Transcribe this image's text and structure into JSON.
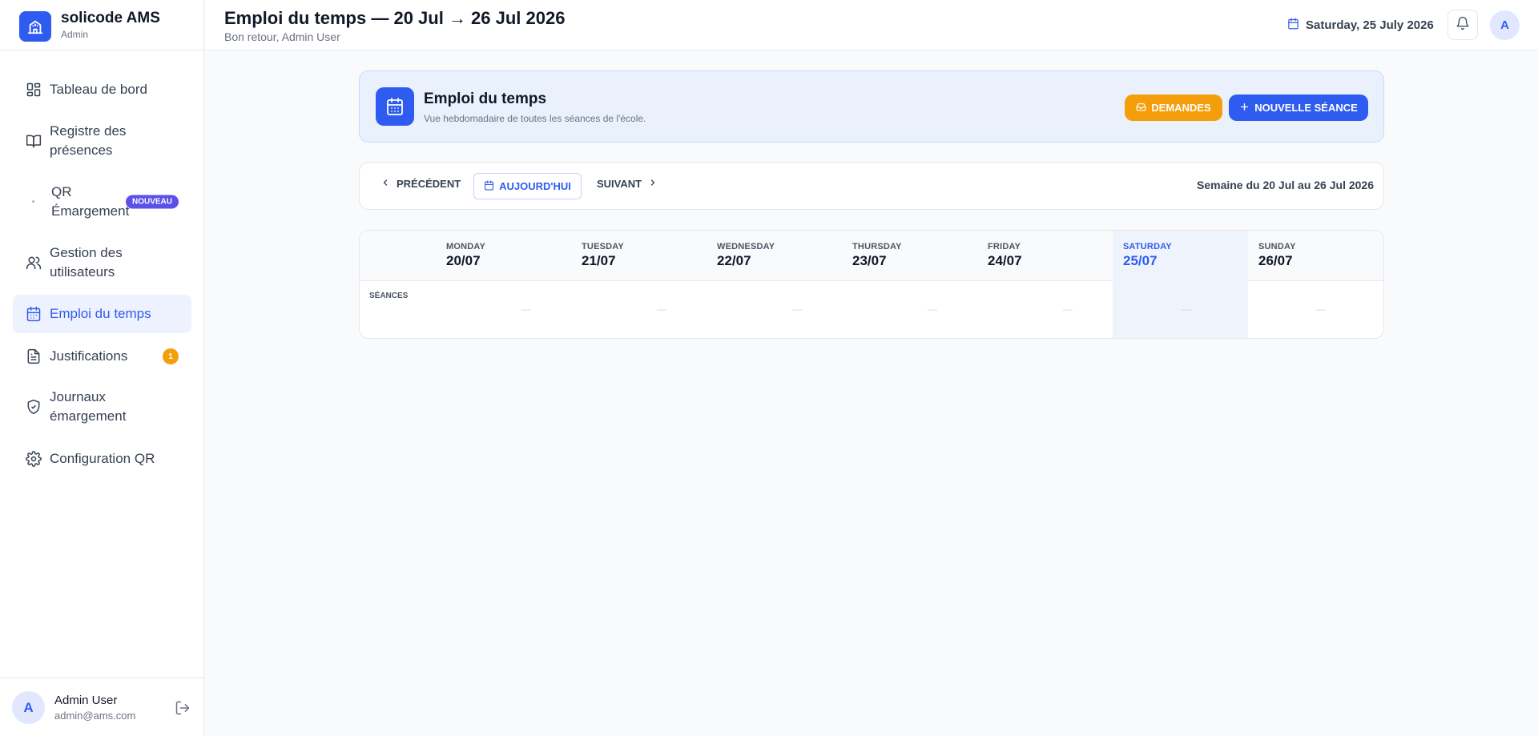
{
  "brand": {
    "name": "solicode AMS",
    "role": "Admin"
  },
  "sidebar": {
    "items": [
      {
        "label": "Tableau de bord",
        "icon": "dashboard-icon"
      },
      {
        "label": "Registre des présences",
        "icon": "book-open-icon"
      },
      {
        "label": "QR Émargement",
        "icon": "qr-icon",
        "badge": "NOUVEAU"
      },
      {
        "label": "Gestion des utilisateurs",
        "icon": "users-icon"
      },
      {
        "label": "Emploi du temps",
        "icon": "calendar-icon",
        "active": true
      },
      {
        "label": "Justifications",
        "icon": "file-text-icon",
        "badge": "1"
      },
      {
        "label": "Journaux émargement",
        "icon": "shield-check-icon"
      },
      {
        "label": "Configuration QR",
        "icon": "gear-icon"
      }
    ]
  },
  "user": {
    "initial": "A",
    "name": "Admin User",
    "email": "admin@ams.com"
  },
  "header": {
    "title": "Emploi du temps — 20 Jul → 26 Jul 2026",
    "subtitle": "Bon retour, Admin User",
    "date": "Saturday, 25 July 2026",
    "avatar_initial": "A"
  },
  "banner": {
    "title": "Emploi du temps",
    "subtitle": "Vue hebdomadaire de toutes les séances de l'école.",
    "demandes_label": "DEMANDES",
    "new_session_label": "NOUVELLE SÉANCE"
  },
  "weeknav": {
    "prev_label": "PRÉCÉDENT",
    "today_label": "AUJOURD'HUI",
    "next_label": "SUIVANT",
    "range_label": "Semaine du 20 Jul au 26 Jul 2026"
  },
  "calendar": {
    "row_label": "SÉANCES",
    "empty_marker": "—",
    "days": [
      {
        "name": "MONDAY",
        "date": "20/07"
      },
      {
        "name": "TUESDAY",
        "date": "21/07"
      },
      {
        "name": "WEDNESDAY",
        "date": "22/07"
      },
      {
        "name": "THURSDAY",
        "date": "23/07"
      },
      {
        "name": "FRIDAY",
        "date": "24/07"
      },
      {
        "name": "SATURDAY",
        "date": "25/07",
        "today": true
      },
      {
        "name": "SUNDAY",
        "date": "26/07"
      }
    ]
  },
  "colors": {
    "accent": "#2f5cf0",
    "warning": "#f59e0b",
    "badge_new": "#5b50e8"
  }
}
